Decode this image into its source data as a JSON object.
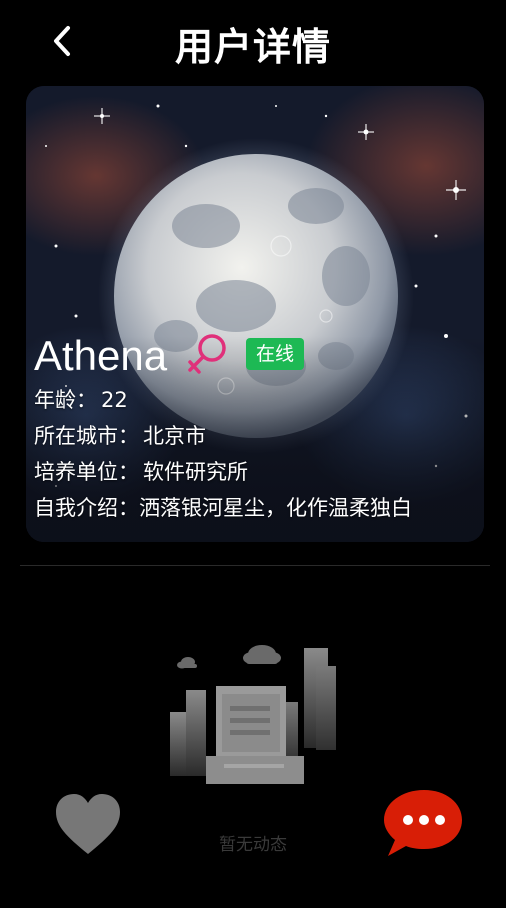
{
  "header": {
    "title": "用户详情",
    "back_icon": "chevron-left-icon"
  },
  "profile": {
    "name": "Athena",
    "gender_icon": "female-icon",
    "gender_color": "#e0307a",
    "status": "在线",
    "status_color": "#1db954",
    "age_label": "年龄：",
    "age": "22",
    "city_label": "所在城市：",
    "city": "北京市",
    "unit_label": "培养单位：",
    "unit": "软件研究所",
    "intro_label": "自我介绍：",
    "intro": "洒落银河星尘，化作温柔独白"
  },
  "feed": {
    "empty_text": "暂无动态",
    "empty_icon": "empty-city-illustration"
  },
  "actions": {
    "like_icon": "heart-icon",
    "like_color": "#777777",
    "chat_icon": "chat-bubble-icon",
    "chat_color": "#d81e06"
  }
}
